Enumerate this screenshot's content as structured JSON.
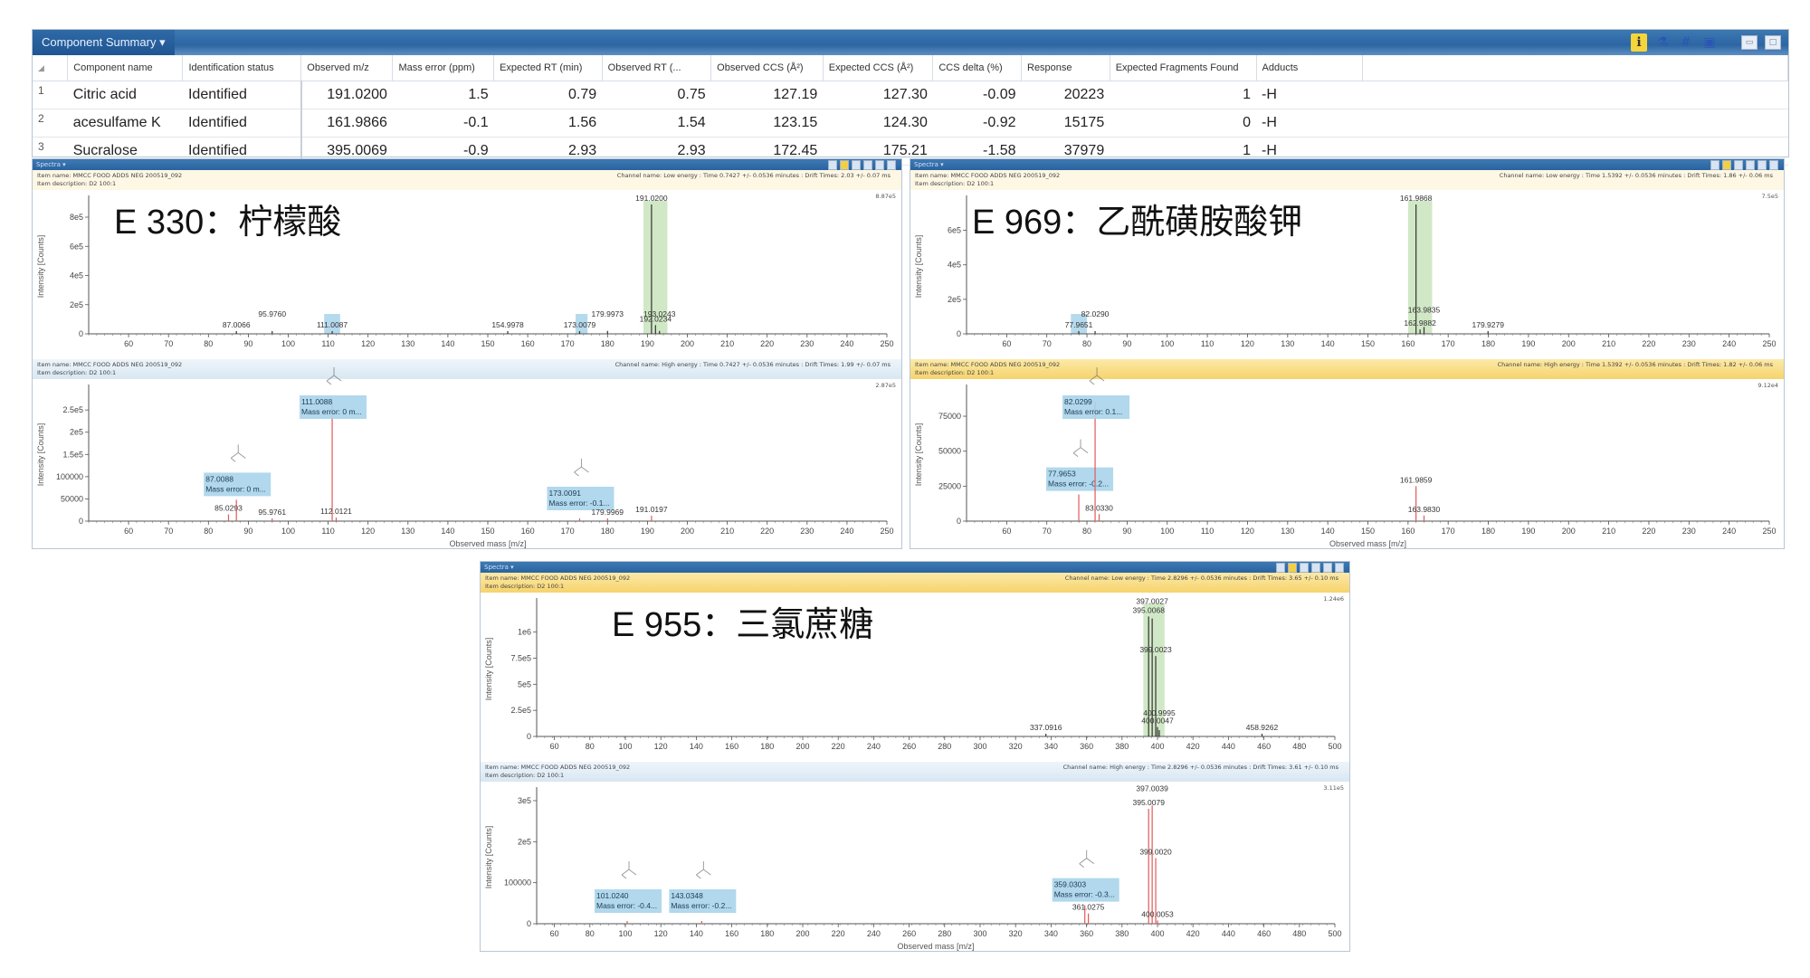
{
  "summary": {
    "title": "Component Summary",
    "toolbar_icons": [
      "info-icon",
      "molecule-icon",
      "hash-icon",
      "report-icon"
    ],
    "columns": [
      "",
      "Component name",
      "Identification status",
      "Observed m/z",
      "Mass error (ppm)",
      "Expected RT (min)",
      "Observed RT (...",
      "Observed CCS (Å²)",
      "Expected CCS (Å²)",
      "CCS delta (%)",
      "Response",
      "Expected Fragments Found",
      "Adducts"
    ],
    "rows": [
      [
        "1",
        "Citric acid",
        "Identified",
        "191.0200",
        "1.5",
        "0.79",
        "0.75",
        "127.19",
        "127.30",
        "-0.09",
        "20223",
        "1",
        "-H"
      ],
      [
        "2",
        "acesulfame K",
        "Identified",
        "161.9866",
        "-0.1",
        "1.56",
        "1.54",
        "123.15",
        "124.30",
        "-0.92",
        "15175",
        "0",
        "-H"
      ],
      [
        "3",
        "Sucralose",
        "Identified",
        "395.0069",
        "-0.9",
        "2.93",
        "2.93",
        "172.45",
        "175.21",
        "-1.58",
        "37979",
        "1",
        "-H"
      ]
    ]
  },
  "colors": {
    "header_blue": "#2d66a3",
    "low_energy_peak": "#333333",
    "high_energy_peak": "#e05a5a",
    "precursor_highlight": "#c9e4bc",
    "fragment_highlight": "#a9d4ea"
  },
  "panels": [
    {
      "id": "citric",
      "menu_label": "Spectra ▾",
      "title": "E 330：柠檬酸",
      "low": {
        "item_name": "Item name: MMCC FOOD ADDS NEG 200519_092",
        "item_desc": "Item description: D2 100:1",
        "channel": "Channel name: Low energy : Time 0.7427 +/- 0.0536 minutes : Drift Times: 2.03 +/- 0.07 ms",
        "max_label": "8.87e5"
      },
      "high": {
        "item_name": "Item name: MMCC FOOD ADDS NEG 200519_092",
        "item_desc": "Item description: D2 100:1",
        "channel": "Channel name: High energy : Time 0.7427 +/- 0.0536 minutes : Drift Times: 1.99 +/- 0.07 ms",
        "max_label": "2.87e5"
      }
    },
    {
      "id": "acesulfame",
      "menu_label": "Spectra ▾",
      "title": "E 969：乙酰磺胺酸钾",
      "low": {
        "item_name": "Item name: MMCC FOOD ADDS NEG 200519_092",
        "item_desc": "Item description: D2 100:1",
        "channel": "Channel name: Low energy : Time 1.5392 +/- 0.0536 minutes : Drift Times: 1.86 +/- 0.06 ms",
        "max_label": "7.5e5"
      },
      "high": {
        "item_name": "Item name: MMCC FOOD ADDS NEG 200519_092",
        "item_desc": "Item description: D2 100:1",
        "channel": "Channel name: High energy : Time 1.5392 +/- 0.0536 minutes : Drift Times: 1.82 +/- 0.06 ms",
        "max_label": "9.12e4"
      }
    },
    {
      "id": "sucralose",
      "menu_label": "Spectra ▾",
      "title": "E 955：三氯蔗糖",
      "low": {
        "item_name": "Item name: MMCC FOOD ADDS NEG 200519_092",
        "item_desc": "Item description: D2 100:1",
        "channel": "Channel name: Low energy : Time 2.8296 +/- 0.0536 minutes : Drift Times: 3.65 +/- 0.10 ms",
        "max_label": "1.24e6"
      },
      "high": {
        "item_name": "Item name: MMCC FOOD ADDS NEG 200519_092",
        "item_desc": "Item description: D2 100:1",
        "channel": "Channel name: High energy : Time 2.8296 +/- 0.0536 minutes : Drift Times: 3.61 +/- 0.10 ms",
        "max_label": "3.11e5"
      }
    }
  ],
  "chart_data": [
    {
      "type": "bar",
      "panel": "citric",
      "channel": "low",
      "xlabel": "",
      "ylabel": "Intensity [Counts]",
      "xlim": [
        50,
        250
      ],
      "ylim": [
        0,
        887000
      ],
      "xticks": [
        60,
        70,
        80,
        90,
        100,
        110,
        120,
        130,
        140,
        150,
        160,
        170,
        180,
        190,
        200,
        210,
        220,
        230,
        240,
        250
      ],
      "yticks": [
        {
          "v": 0,
          "l": "0"
        },
        {
          "v": 200000,
          "l": "2e5"
        },
        {
          "v": 400000,
          "l": "4e5"
        },
        {
          "v": 600000,
          "l": "6e5"
        },
        {
          "v": 800000,
          "l": "8e5"
        }
      ],
      "highlights": [
        {
          "x0": 109,
          "x1": 113,
          "kind": "fragment"
        },
        {
          "x0": 172,
          "x1": 175,
          "kind": "fragment"
        },
        {
          "x0": 189,
          "x1": 195,
          "kind": "precursor"
        }
      ],
      "peaks": [
        {
          "mz": 87.0066,
          "y": 3000,
          "label": "87.0066"
        },
        {
          "mz": 95.976,
          "y": 3000,
          "label": "95.9760"
        },
        {
          "mz": 111.0087,
          "y": 15000,
          "label": "111.0087"
        },
        {
          "mz": 154.9978,
          "y": 2000,
          "label": "154.9978"
        },
        {
          "mz": 173.0079,
          "y": 8000,
          "label": "173.0079"
        },
        {
          "mz": 179.9973,
          "y": 20000,
          "label": "179.9973"
        },
        {
          "mz": 191.02,
          "y": 887000,
          "label": "191.0200"
        },
        {
          "mz": 192.0234,
          "y": 60000,
          "label": "192.0234"
        },
        {
          "mz": 193.0243,
          "y": 20000,
          "label": "193.0243"
        }
      ]
    },
    {
      "type": "bar",
      "panel": "citric",
      "channel": "high",
      "xlabel": "Observed mass [m/z]",
      "ylabel": "Intensity [Counts]",
      "xlim": [
        50,
        250
      ],
      "ylim": [
        0,
        287000
      ],
      "xticks": [
        60,
        70,
        80,
        90,
        100,
        110,
        120,
        130,
        140,
        150,
        160,
        170,
        180,
        190,
        200,
        210,
        220,
        230,
        240,
        250
      ],
      "yticks": [
        {
          "v": 0,
          "l": "0"
        },
        {
          "v": 50000,
          "l": "50000"
        },
        {
          "v": 100000,
          "l": "100000"
        },
        {
          "v": 150000,
          "l": "1.5e5"
        },
        {
          "v": 200000,
          "l": "2e5"
        },
        {
          "v": 250000,
          "l": "2.5e5"
        }
      ],
      "peaks": [
        {
          "mz": 85.0293,
          "y": 15000,
          "label": "85.0293"
        },
        {
          "mz": 87.0088,
          "y": 48000,
          "label": "87.0088",
          "box": "87.0088\nMass error: 0 m..."
        },
        {
          "mz": 95.9761,
          "y": 5000,
          "label": "95.9761"
        },
        {
          "mz": 111.0088,
          "y": 267000,
          "label": "111.0088",
          "box": "111.0088\nMass error: 0 m..."
        },
        {
          "mz": 112.0121,
          "y": 8000,
          "label": "112.0121"
        },
        {
          "mz": 173.0091,
          "y": 3000,
          "label": "173.0091",
          "box": "173.0091\nMass error: -0.1..."
        },
        {
          "mz": 179.9969,
          "y": 2000,
          "label": "179.9969"
        },
        {
          "mz": 191.0197,
          "y": 12000,
          "label": "191.0197"
        }
      ]
    },
    {
      "type": "bar",
      "panel": "acesulfame",
      "channel": "low",
      "xlabel": "",
      "ylabel": "Intensity [Counts]",
      "xlim": [
        50,
        250
      ],
      "ylim": [
        0,
        750000
      ],
      "xticks": [
        60,
        70,
        80,
        90,
        100,
        110,
        120,
        130,
        140,
        150,
        160,
        170,
        180,
        190,
        200,
        210,
        220,
        230,
        240,
        250
      ],
      "yticks": [
        {
          "v": 0,
          "l": "0"
        },
        {
          "v": 200000,
          "l": "2e5"
        },
        {
          "v": 400000,
          "l": "4e5"
        },
        {
          "v": 600000,
          "l": "6e5"
        }
      ],
      "highlights": [
        {
          "x0": 76,
          "x1": 80,
          "kind": "fragment"
        },
        {
          "x0": 160,
          "x1": 166,
          "kind": "precursor"
        }
      ],
      "peaks": [
        {
          "mz": 77.9651,
          "y": 3000,
          "label": "77.9651"
        },
        {
          "mz": 82.029,
          "y": 4000,
          "label": "82.0290"
        },
        {
          "mz": 161.9868,
          "y": 750000,
          "label": "161.9868"
        },
        {
          "mz": 162.9882,
          "y": 25000,
          "label": "162.9882"
        },
        {
          "mz": 163.9835,
          "y": 40000,
          "label": "163.9835"
        },
        {
          "mz": 179.9279,
          "y": 3000,
          "label": "179.9279"
        }
      ]
    },
    {
      "type": "bar",
      "panel": "acesulfame",
      "channel": "high",
      "xlabel": "Observed mass [m/z]",
      "ylabel": "Intensity [Counts]",
      "xlim": [
        50,
        250
      ],
      "ylim": [
        0,
        91200
      ],
      "xticks": [
        60,
        70,
        80,
        90,
        100,
        110,
        120,
        130,
        140,
        150,
        160,
        170,
        180,
        190,
        200,
        210,
        220,
        230,
        240,
        250
      ],
      "yticks": [
        {
          "v": 0,
          "l": "0"
        },
        {
          "v": 25000,
          "l": "25000"
        },
        {
          "v": 50000,
          "l": "50000"
        },
        {
          "v": 75000,
          "l": "75000"
        }
      ],
      "peaks": [
        {
          "mz": 77.9653,
          "y": 19000,
          "label": "77.9653",
          "box": "77.9653\nMass error: -0.2..."
        },
        {
          "mz": 82.0299,
          "y": 85000,
          "label": "82.0299",
          "box": "82.0299\nMass error: 0.1..."
        },
        {
          "mz": 83.033,
          "y": 5000,
          "label": "83.0330"
        },
        {
          "mz": 161.9859,
          "y": 25000,
          "label": "161.9859"
        },
        {
          "mz": 163.983,
          "y": 4000,
          "label": "163.9830"
        }
      ]
    },
    {
      "type": "bar",
      "panel": "sucralose",
      "channel": "low",
      "xlabel": "",
      "ylabel": "Intensity [Counts]",
      "xlim": [
        50,
        500
      ],
      "ylim": [
        0,
        1240000
      ],
      "xticks": [
        60,
        80,
        100,
        120,
        140,
        160,
        180,
        200,
        220,
        240,
        260,
        280,
        300,
        320,
        340,
        360,
        380,
        400,
        420,
        440,
        460,
        480,
        500
      ],
      "yticks": [
        {
          "v": 0,
          "l": "0"
        },
        {
          "v": 250000,
          "l": "2.5e5"
        },
        {
          "v": 500000,
          "l": "5e5"
        },
        {
          "v": 750000,
          "l": "7.5e5"
        },
        {
          "v": 1000000,
          "l": "1e6"
        }
      ],
      "highlights": [
        {
          "x0": 392,
          "x1": 404,
          "kind": "precursor"
        }
      ],
      "peaks": [
        {
          "mz": 337.0916,
          "y": 3000,
          "label": "337.0916"
        },
        {
          "mz": 395.0068,
          "y": 1150000,
          "label": "395.0068"
        },
        {
          "mz": 397.0027,
          "y": 1130000,
          "label": "397.0027"
        },
        {
          "mz": 399.0023,
          "y": 770000,
          "label": "399.0023"
        },
        {
          "mz": 400.0047,
          "y": 90000,
          "label": "400.0047"
        },
        {
          "mz": 400.9995,
          "y": 60000,
          "label": "400.9995"
        },
        {
          "mz": 458.9262,
          "y": 3000,
          "label": "458.9262"
        }
      ]
    },
    {
      "type": "bar",
      "panel": "sucralose",
      "channel": "high",
      "xlabel": "Observed mass [m/z]",
      "ylabel": "Intensity [Counts]",
      "xlim": [
        50,
        500
      ],
      "ylim": [
        0,
        311000
      ],
      "xticks": [
        60,
        80,
        100,
        120,
        140,
        160,
        180,
        200,
        220,
        240,
        260,
        280,
        300,
        320,
        340,
        360,
        380,
        400,
        420,
        440,
        460,
        480,
        500
      ],
      "yticks": [
        {
          "v": 0,
          "l": "0"
        },
        {
          "v": 100000,
          "l": "100000"
        },
        {
          "v": 200000,
          "l": "2e5"
        },
        {
          "v": 300000,
          "l": "3e5"
        }
      ],
      "peaks": [
        {
          "mz": 101.024,
          "y": 2000,
          "label": "101.0240",
          "box": "101.0240\nMass error: -0.4..."
        },
        {
          "mz": 143.0348,
          "y": 2000,
          "label": "143.0348",
          "box": "143.0348\nMass error: -0.2..."
        },
        {
          "mz": 359.0303,
          "y": 45000,
          "label": "359.0303",
          "box": "359.0303\nMass error: -0.3..."
        },
        {
          "mz": 361.0275,
          "y": 25000,
          "label": "361.0275"
        },
        {
          "mz": 395.0079,
          "y": 280000,
          "label": "395.0079"
        },
        {
          "mz": 397.0039,
          "y": 288000,
          "label": "397.0039"
        },
        {
          "mz": 399.002,
          "y": 160000,
          "label": "399.0020"
        },
        {
          "mz": 400.0053,
          "y": 8000,
          "label": "400.0053"
        }
      ]
    }
  ]
}
